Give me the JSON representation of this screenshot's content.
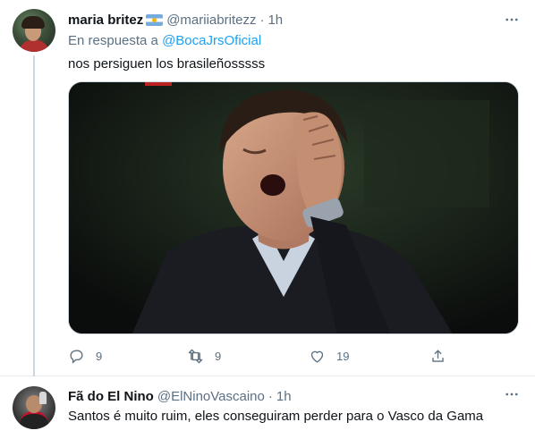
{
  "tweets": [
    {
      "display_name": "maria britez",
      "flag_icon": "argentina-flag-icon",
      "handle": "@mariiabritezz",
      "separator": "·",
      "time": "1h",
      "reply_prefix": "En respuesta a",
      "reply_to": "@BocaJrsOficial",
      "text": "nos persiguen los brasileñosssss",
      "media": "photo",
      "actions": {
        "replies": "9",
        "retweets": "9",
        "likes": "19"
      }
    },
    {
      "display_name": "Fã do El Nino",
      "handle": "@ElNinoVascaino",
      "separator": "·",
      "time": "1h",
      "text": "Santos é muito ruim, eles conseguiram perder para o Vasco da Gama"
    }
  ],
  "colors": {
    "accent": "#1da1f2",
    "muted": "#5b7083",
    "text": "#0f1419",
    "border": "#e6ecf0"
  }
}
